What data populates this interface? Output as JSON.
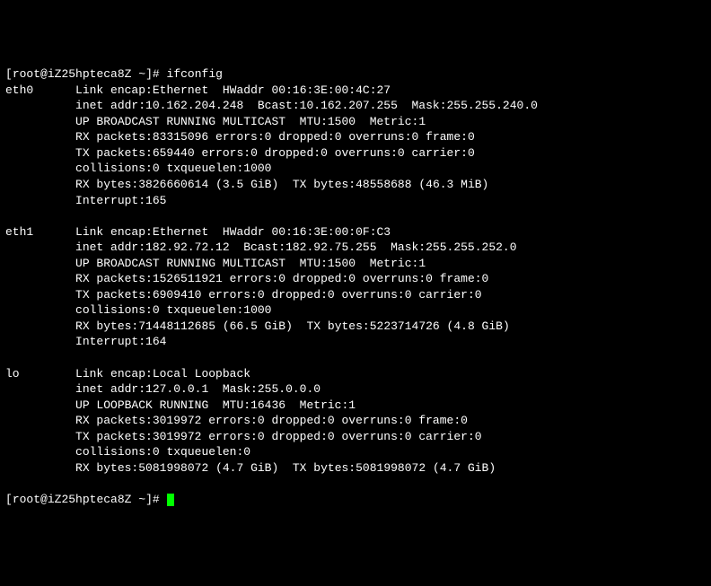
{
  "prompt": {
    "user": "root",
    "host": "iZ25hpteca8Z",
    "path": "~",
    "symbol": "#",
    "command": "ifconfig"
  },
  "interfaces": [
    {
      "name": "eth0",
      "link_encap": "Ethernet",
      "hwaddr": "00:16:3E:00:4C:27",
      "inet_addr": "10.162.204.248",
      "bcast": "10.162.207.255",
      "mask": "255.255.240.0",
      "flags": "UP BROADCAST RUNNING MULTICAST",
      "mtu": "1500",
      "metric": "1",
      "rx_packets": "83315096",
      "rx_errors": "0",
      "rx_dropped": "0",
      "rx_overruns": "0",
      "rx_frame": "0",
      "tx_packets": "659440",
      "tx_errors": "0",
      "tx_dropped": "0",
      "tx_overruns": "0",
      "tx_carrier": "0",
      "collisions": "0",
      "txqueuelen": "1000",
      "rx_bytes": "3826660614",
      "rx_bytes_h": "(3.5 GiB)",
      "tx_bytes": "48558688",
      "tx_bytes_h": "(46.3 MiB)",
      "interrupt": "165"
    },
    {
      "name": "eth1",
      "link_encap": "Ethernet",
      "hwaddr": "00:16:3E:00:0F:C3",
      "inet_addr": "182.92.72.12",
      "bcast": "182.92.75.255",
      "mask": "255.255.252.0",
      "flags": "UP BROADCAST RUNNING MULTICAST",
      "mtu": "1500",
      "metric": "1",
      "rx_packets": "1526511921",
      "rx_errors": "0",
      "rx_dropped": "0",
      "rx_overruns": "0",
      "rx_frame": "0",
      "tx_packets": "6909410",
      "tx_errors": "0",
      "tx_dropped": "0",
      "tx_overruns": "0",
      "tx_carrier": "0",
      "collisions": "0",
      "txqueuelen": "1000",
      "rx_bytes": "71448112685",
      "rx_bytes_h": "(66.5 GiB)",
      "tx_bytes": "5223714726",
      "tx_bytes_h": "(4.8 GiB)",
      "interrupt": "164"
    },
    {
      "name": "lo",
      "link_encap": "Local Loopback",
      "hwaddr": "",
      "inet_addr": "127.0.0.1",
      "bcast": "",
      "mask": "255.0.0.0",
      "flags": "UP LOOPBACK RUNNING",
      "mtu": "16436",
      "metric": "1",
      "rx_packets": "3019972",
      "rx_errors": "0",
      "rx_dropped": "0",
      "rx_overruns": "0",
      "rx_frame": "0",
      "tx_packets": "3019972",
      "tx_errors": "0",
      "tx_dropped": "0",
      "tx_overruns": "0",
      "tx_carrier": "0",
      "collisions": "0",
      "txqueuelen": "0",
      "rx_bytes": "5081998072",
      "rx_bytes_h": "(4.7 GiB)",
      "tx_bytes": "5081998072",
      "tx_bytes_h": "(4.7 GiB)",
      "interrupt": ""
    }
  ],
  "prompt2": {
    "user": "root",
    "host": "iZ25hpteca8Z",
    "path": "~",
    "symbol": "#"
  }
}
